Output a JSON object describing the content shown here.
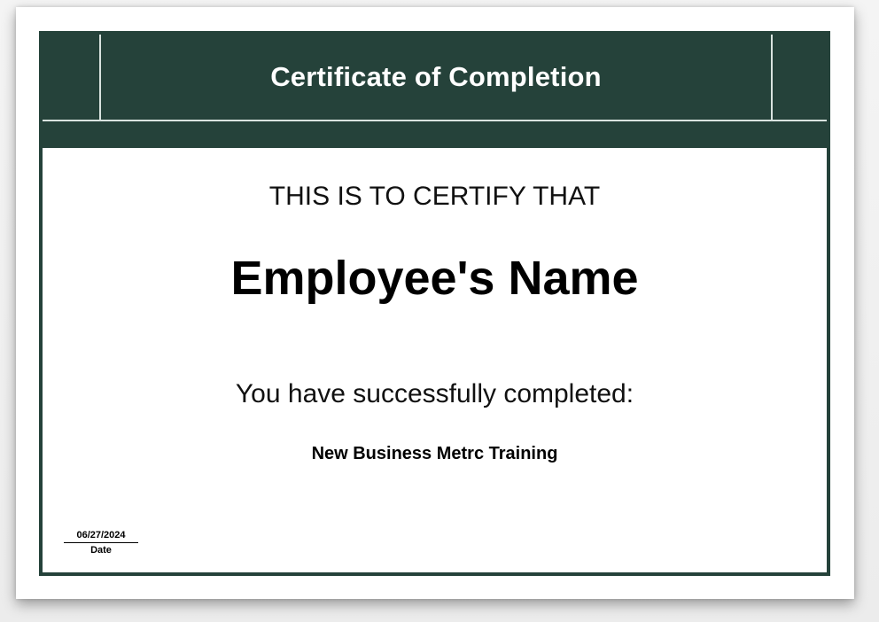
{
  "certificate": {
    "title": "Certificate of Completion",
    "certify_text": "THIS IS TO CERTIFY THAT",
    "recipient_name": "Employee's Name",
    "completed_text": "You have successfully completed:",
    "course_name": "New Business Metrc Training",
    "date_value": "06/27/2024",
    "date_label": "Date"
  },
  "colors": {
    "band": "#25423a",
    "band_rules": "#d9e3df",
    "text": "#000000",
    "paper": "#ffffff"
  }
}
